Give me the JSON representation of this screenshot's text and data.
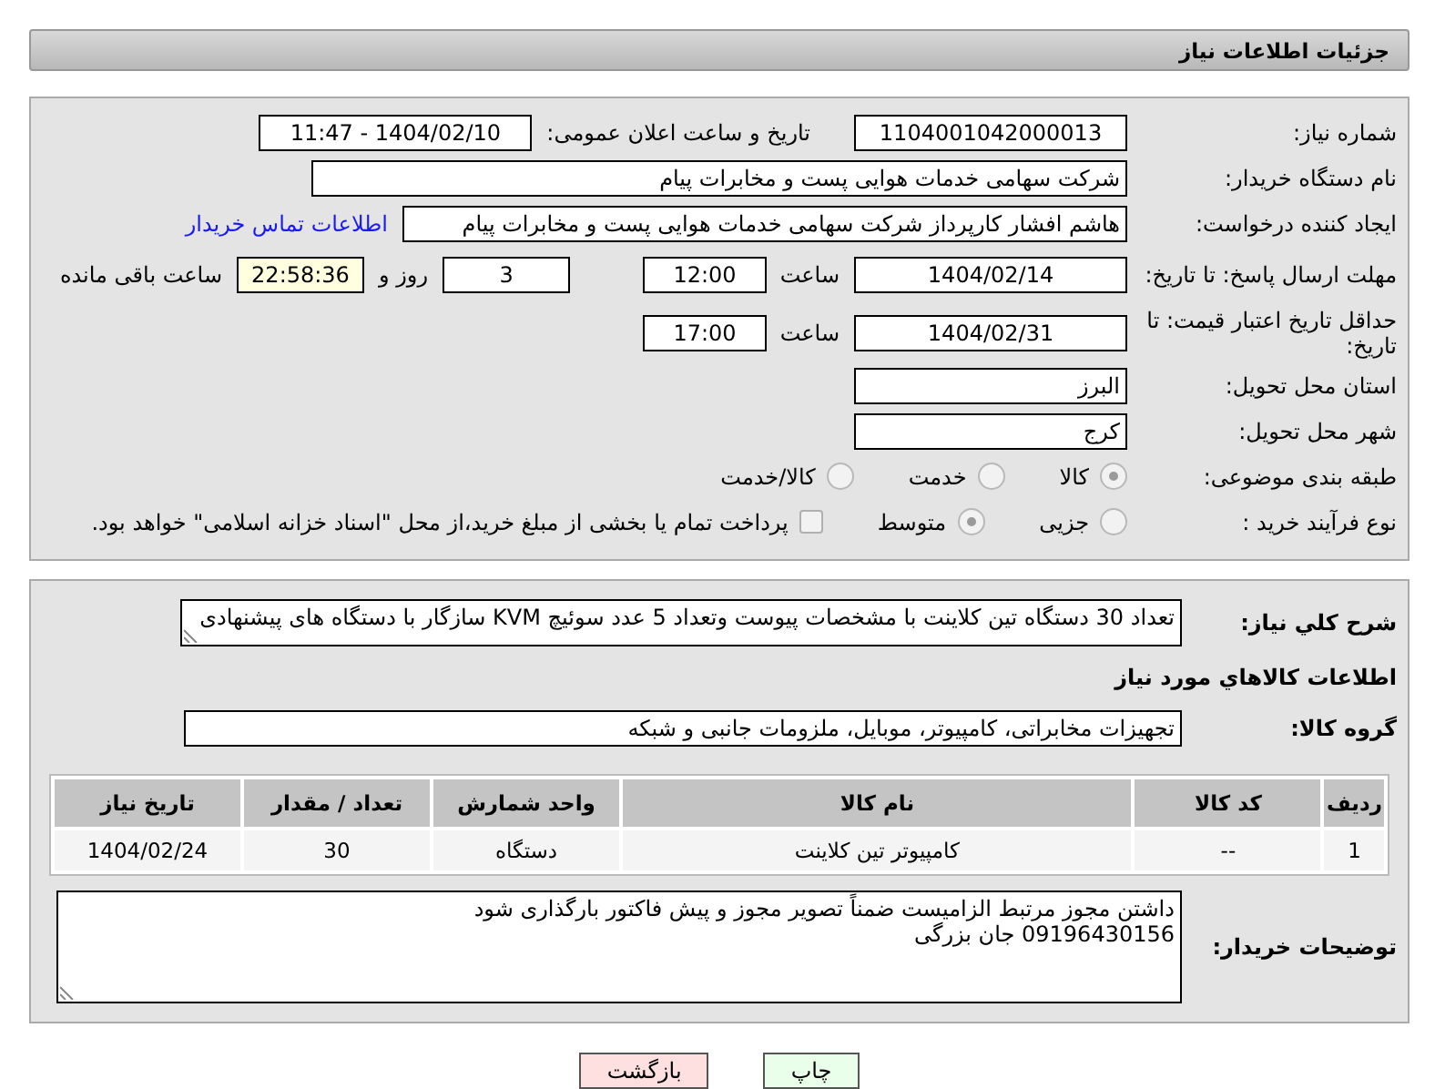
{
  "header": {
    "title": "جزئیات اطلاعات نیاز"
  },
  "need_number": {
    "label": "شماره نیاز:",
    "value": "1104001042000013"
  },
  "announce": {
    "label": "تاریخ و ساعت اعلان عمومی:",
    "value": "1404/02/10 - 11:47"
  },
  "buyer_org": {
    "label": "نام دستگاه خریدار:",
    "value": "شرکت سهامی خدمات هوایی پست و مخابرات پیام"
  },
  "creator": {
    "label": "ایجاد کننده درخواست:",
    "value": "هاشم افشار کارپرداز شرکت سهامی خدمات هوایی پست و مخابرات پیام",
    "link": "اطلاعات تماس خریدار"
  },
  "deadline": {
    "label": "مهلت ارسال پاسخ: تا تاریخ:",
    "date": "1404/02/14",
    "time_label": "ساعت",
    "time": "12:00",
    "days": "3",
    "days_label": "روز و",
    "remaining": "22:58:36",
    "remaining_label": "ساعت باقی مانده"
  },
  "validity": {
    "label": "حداقل تاریخ اعتبار قیمت: تا تاریخ:",
    "date": "1404/02/31",
    "time_label": "ساعت",
    "time": "17:00"
  },
  "province": {
    "label": "استان محل تحویل:",
    "value": "البرز"
  },
  "city": {
    "label": "شهر محل تحویل:",
    "value": "کرج"
  },
  "category": {
    "label": "طبقه بندی موضوعی:",
    "options": [
      {
        "label": "کالا",
        "selected": true
      },
      {
        "label": "خدمت",
        "selected": false
      },
      {
        "label": "کالا/خدمت",
        "selected": false
      }
    ]
  },
  "process": {
    "label": "نوع فرآیند خرید :",
    "options": [
      {
        "label": "جزیی",
        "selected": false
      },
      {
        "label": "متوسط",
        "selected": true
      }
    ],
    "treasury": {
      "label": "پرداخت تمام یا بخشی از مبلغ خرید،از محل \"اسناد خزانه اسلامی\" خواهد بود.",
      "checked": false
    }
  },
  "description": {
    "label": "شرح کلي نياز:",
    "value": "تعداد 30 دستگاه تین کلاینت با مشخصات پیوست وتعداد 5 عدد سوئیچ KVM سازگار با دستگاه های پیشنهادی"
  },
  "goods_heading": "اطلاعات کالاهاي مورد نياز",
  "goods_group": {
    "label": "گروه کالا:",
    "value": "تجهیزات مخابراتی، کامپیوتر، موبایل، ملزومات جانبی و شبکه"
  },
  "table": {
    "columns": [
      "ردیف",
      "کد کالا",
      "نام کالا",
      "واحد شمارش",
      "تعداد / مقدار",
      "تاریخ نیاز"
    ],
    "rows": [
      [
        "1",
        "--",
        "کامپیوتر تین کلاینت",
        "دستگاه",
        "30",
        "1404/02/24"
      ]
    ]
  },
  "buyer_notes": {
    "label": "توضیحات خریدار:",
    "lines": [
      "داشتن مجوز مرتبط الزامیست ضمناً تصویر مجوز و پیش فاکتور بارگذاری شود",
      "09196430156 جان بزرگی"
    ]
  },
  "buttons": [
    {
      "label": "چاپ",
      "kind": "print"
    },
    {
      "label": "بازگشت",
      "kind": "back"
    }
  ]
}
